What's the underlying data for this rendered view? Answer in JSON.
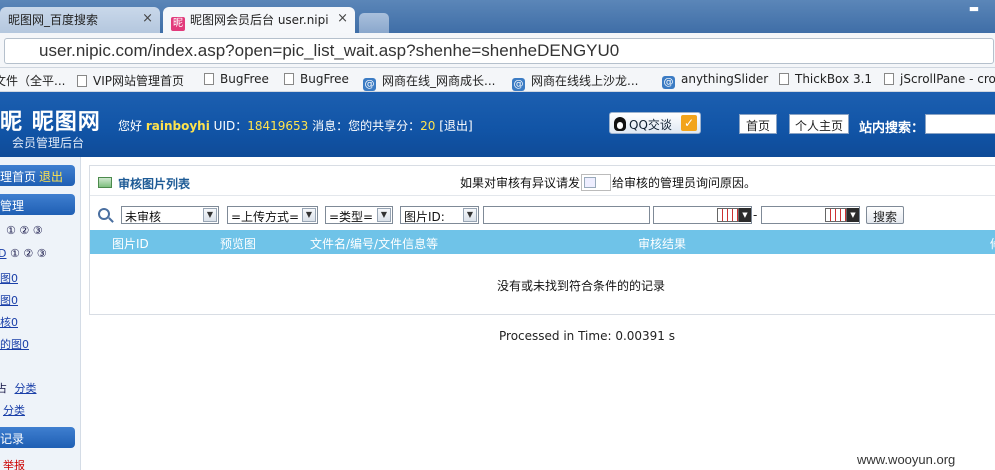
{
  "browser": {
    "tabs": [
      {
        "title": "昵图网_百度搜索"
      },
      {
        "title": "昵图网会员后台 user.nipi"
      }
    ],
    "url": "user.nipic.com/index.asp?open=pic_list_wait.asp?shenhe=shenheDENGYU0",
    "bookmarks": [
      {
        "label": "文件（全平...",
        "icon": "doc-icon"
      },
      {
        "label": "VIP网站管理首页",
        "icon": "doc-icon"
      },
      {
        "label": "BugFree",
        "icon": "doc-icon"
      },
      {
        "label": "BugFree",
        "icon": "doc-icon"
      },
      {
        "label": "网商在线_网商成长...",
        "icon": "at-icon"
      },
      {
        "label": "网商在线线上沙龙...",
        "icon": "at-icon"
      },
      {
        "label": "anythingSlider",
        "icon": "at-icon"
      },
      {
        "label": "ThickBox 3.1",
        "icon": "doc-icon"
      },
      {
        "label": "jScrollPane - cro",
        "icon": "doc-icon"
      }
    ]
  },
  "header": {
    "logo_title": "昵图网",
    "logo_mark": "昵",
    "logo_sub": "会员管理后台",
    "greeting_prefix": "您好",
    "username": "rainboyhi",
    "uid_label": "UID：",
    "uid": "18419653",
    "messages_label": "消息：",
    "share_label": "您的共享分：",
    "share_score": "20",
    "logout": "[退出]",
    "qq_label": "QQ交谈",
    "home_button": "首页",
    "personal_button": "个人主页",
    "search_label": "站内搜索："
  },
  "sidebar": {
    "home_link": "理首页",
    "logout_link": "退出",
    "section_manage": "管理",
    "rows": [
      {
        "prefix": "",
        "circled": "① ② ③"
      },
      {
        "prefix": "D",
        "circled": "① ② ③"
      }
    ],
    "links": [
      {
        "label": "图",
        "count": "0"
      },
      {
        "label": "图",
        "count": "0"
      },
      {
        "label": "核",
        "count": "0"
      },
      {
        "label": "的图",
        "count": "0"
      }
    ],
    "category_1": "分类",
    "category_2": "分类",
    "category_prefix": "占",
    "section_records": "记录",
    "report": "举报"
  },
  "panel": {
    "title": "审核图片列表",
    "notice_before": "如果对审核有异议请发",
    "notice_after": "给审核的管理员询问原因。",
    "filters": {
      "status": "未审核",
      "upload": "=上传方式=",
      "type": "=类型=",
      "picid": "图片ID:",
      "date_separator": "-",
      "search_button": "搜索"
    },
    "columns": [
      "图片ID",
      "预览图",
      "文件名/编号/文件信息等",
      "审核结果",
      "修"
    ],
    "empty_message": "没有或未找到符合条件的的记录"
  },
  "footer": {
    "processed": "Processed in Time: 0.00391 s",
    "watermark": "www.wooyun.org"
  },
  "colors": {
    "header_blue": "#1154a6",
    "table_header": "#6fc3e8",
    "highlight_yellow": "#ffe34d",
    "title_blue": "#1e5b96"
  }
}
